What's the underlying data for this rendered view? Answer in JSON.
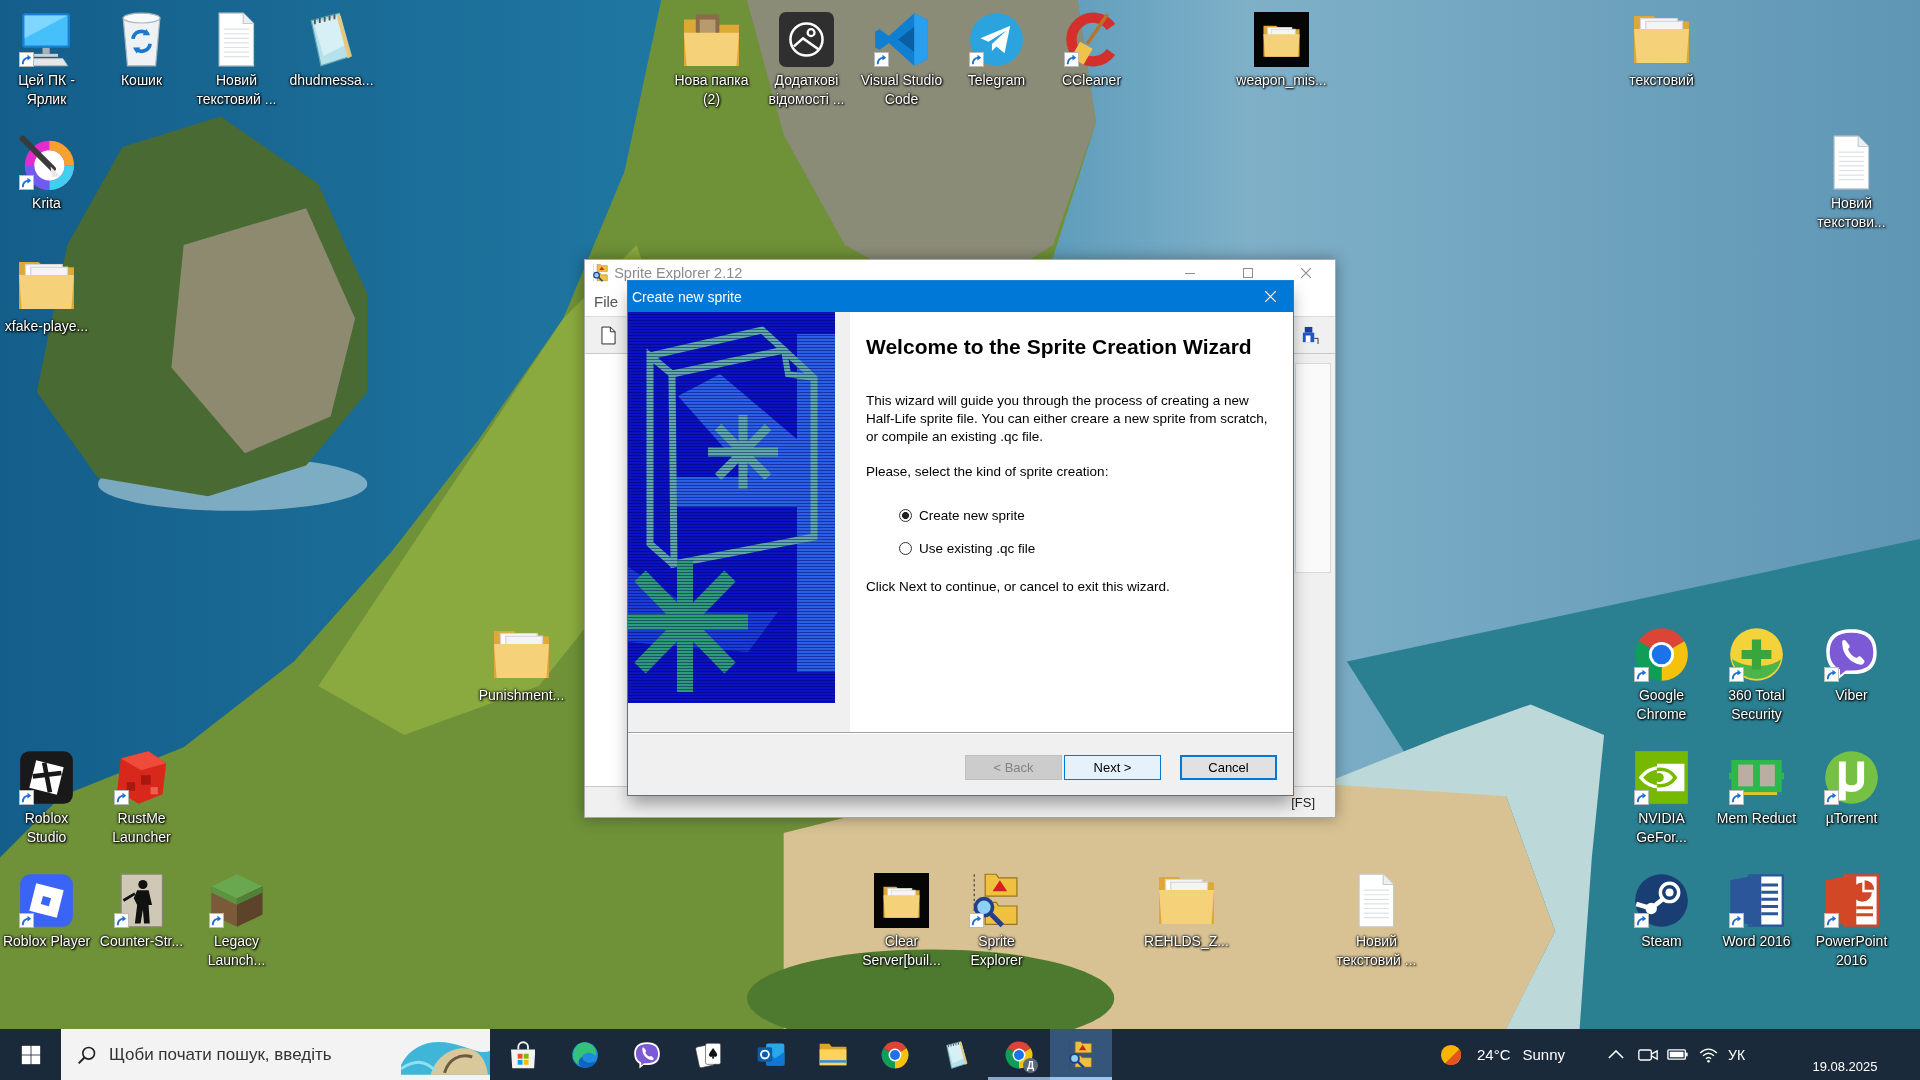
{
  "desktop": {
    "icons": [
      {
        "label": "Цей ПК -\nЯрлик",
        "kind": "computer",
        "shortcut": true
      },
      {
        "label": "Кошик",
        "kind": "bin",
        "shortcut": false
      },
      {
        "label": "Новий\nтекстовий ...",
        "kind": "document",
        "shortcut": false
      },
      {
        "label": "dhudmessa...",
        "kind": "notepad",
        "shortcut": false
      },
      {
        "label": "Нова папка\n(2)",
        "kind": "photofolder",
        "shortcut": false
      },
      {
        "label": "Додаткові\nвідомості ...",
        "kind": "tile",
        "shortcut": false
      },
      {
        "label": "Visual Studio\nCode",
        "kind": "ribbon",
        "shortcut": true
      },
      {
        "label": "Telegram",
        "kind": "plane",
        "shortcut": true
      },
      {
        "label": "CCleaner",
        "kind": "cleaner",
        "shortcut": true
      },
      {
        "label": "weapon_mis...",
        "kind": "darkfolder",
        "shortcut": false
      },
      {
        "label": "текстовий",
        "kind": "folder",
        "shortcut": false
      },
      {
        "label": "Krita",
        "kind": "brush",
        "shortcut": true
      },
      {
        "label": "Новий\nтекстови...",
        "kind": "document",
        "shortcut": false
      },
      {
        "label": "xfake-playe...",
        "kind": "folder",
        "shortcut": false
      },
      {
        "label": "Punishment...",
        "kind": "folder",
        "shortcut": false
      },
      {
        "label": "Google\nChrome",
        "kind": "ring",
        "shortcut": true
      },
      {
        "label": "360 Total\nSecurity",
        "kind": "plus",
        "shortcut": true
      },
      {
        "label": "Viber",
        "kind": "phone",
        "shortcut": true
      },
      {
        "label": "Roblox\nStudio",
        "kind": "studio",
        "shortcut": true
      },
      {
        "label": "RustMe\nLauncher",
        "kind": "cube",
        "shortcut": true
      },
      {
        "label": "NVIDIA\nGeFor...",
        "kind": "eye",
        "shortcut": true
      },
      {
        "label": "Mem Reduct",
        "kind": "chip",
        "shortcut": true
      },
      {
        "label": "µTorrent",
        "kind": "hook",
        "shortcut": true
      },
      {
        "label": "Roblox Player",
        "kind": "player",
        "shortcut": true
      },
      {
        "label": "Counter-Str...",
        "kind": "soldier",
        "shortcut": true
      },
      {
        "label": "Legacy\nLaunch...",
        "kind": "grass",
        "shortcut": true
      },
      {
        "label": "Clear\nServer[buil...",
        "kind": "darkfolder",
        "shortcut": false
      },
      {
        "label": "Sprite\nExplorer",
        "kind": "sprite",
        "shortcut": true
      },
      {
        "label": "REHLDS_Z...",
        "kind": "folder",
        "shortcut": false
      },
      {
        "label": "Новий\nтекстовий ...",
        "kind": "document",
        "shortcut": false
      },
      {
        "label": "Steam",
        "kind": "piston",
        "shortcut": true
      },
      {
        "label": "Word 2016",
        "kind": "word",
        "shortcut": true
      },
      {
        "label": "PowerPoint\n2016",
        "kind": "slides",
        "shortcut": true
      }
    ]
  },
  "main_window": {
    "title": "Sprite Explorer 2.12",
    "active": false,
    "menu": [
      {
        "label": "File"
      }
    ],
    "status": "[FS]"
  },
  "dialog": {
    "title": "Create new sprite",
    "active": true,
    "heading": "Welcome to the Sprite Creation Wizard",
    "intro": "This wizard will guide you through the process of creating a new\nHalf-Life sprite file. You can either creare a new sprite from scratch,\nor compile an existing .qc file.",
    "prompt": "Please, select the kind of sprite creation:",
    "options": [
      {
        "label": "Create new sprite",
        "selected": true
      },
      {
        "label": "Use existing .qc file",
        "selected": false
      }
    ],
    "hint": "Click Next to continue, or cancel to exit this wizard.",
    "buttons": [
      {
        "label": "< Back",
        "disabled": true,
        "hovered": false,
        "focused": false
      },
      {
        "label": "Next >",
        "disabled": false,
        "hovered": true,
        "focused": false
      },
      {
        "label": "Cancel",
        "disabled": false,
        "hovered": false,
        "focused": true
      }
    ]
  },
  "taskbar": {
    "search": {
      "placeholder": "Щоби почати пошук, введіть"
    },
    "apps": [
      {
        "kind": "store",
        "running": false,
        "selected": false
      },
      {
        "kind": "swirl",
        "running": false,
        "selected": false
      },
      {
        "kind": "phone",
        "running": false,
        "selected": false
      },
      {
        "kind": "cards",
        "running": false,
        "selected": false
      },
      {
        "kind": "mail",
        "running": false,
        "selected": false
      },
      {
        "kind": "files",
        "running": false,
        "selected": false
      },
      {
        "kind": "ring",
        "running": false,
        "selected": false
      },
      {
        "kind": "notepad",
        "running": false,
        "selected": false
      },
      {
        "kind": "ring",
        "badge": "Д",
        "running": true,
        "selected": false
      },
      {
        "kind": "sprite",
        "running": true,
        "selected": true
      }
    ],
    "weather": {
      "temperature": "24°C",
      "condition": "Sunny"
    },
    "language": "УК",
    "date": "19.08.2025"
  }
}
